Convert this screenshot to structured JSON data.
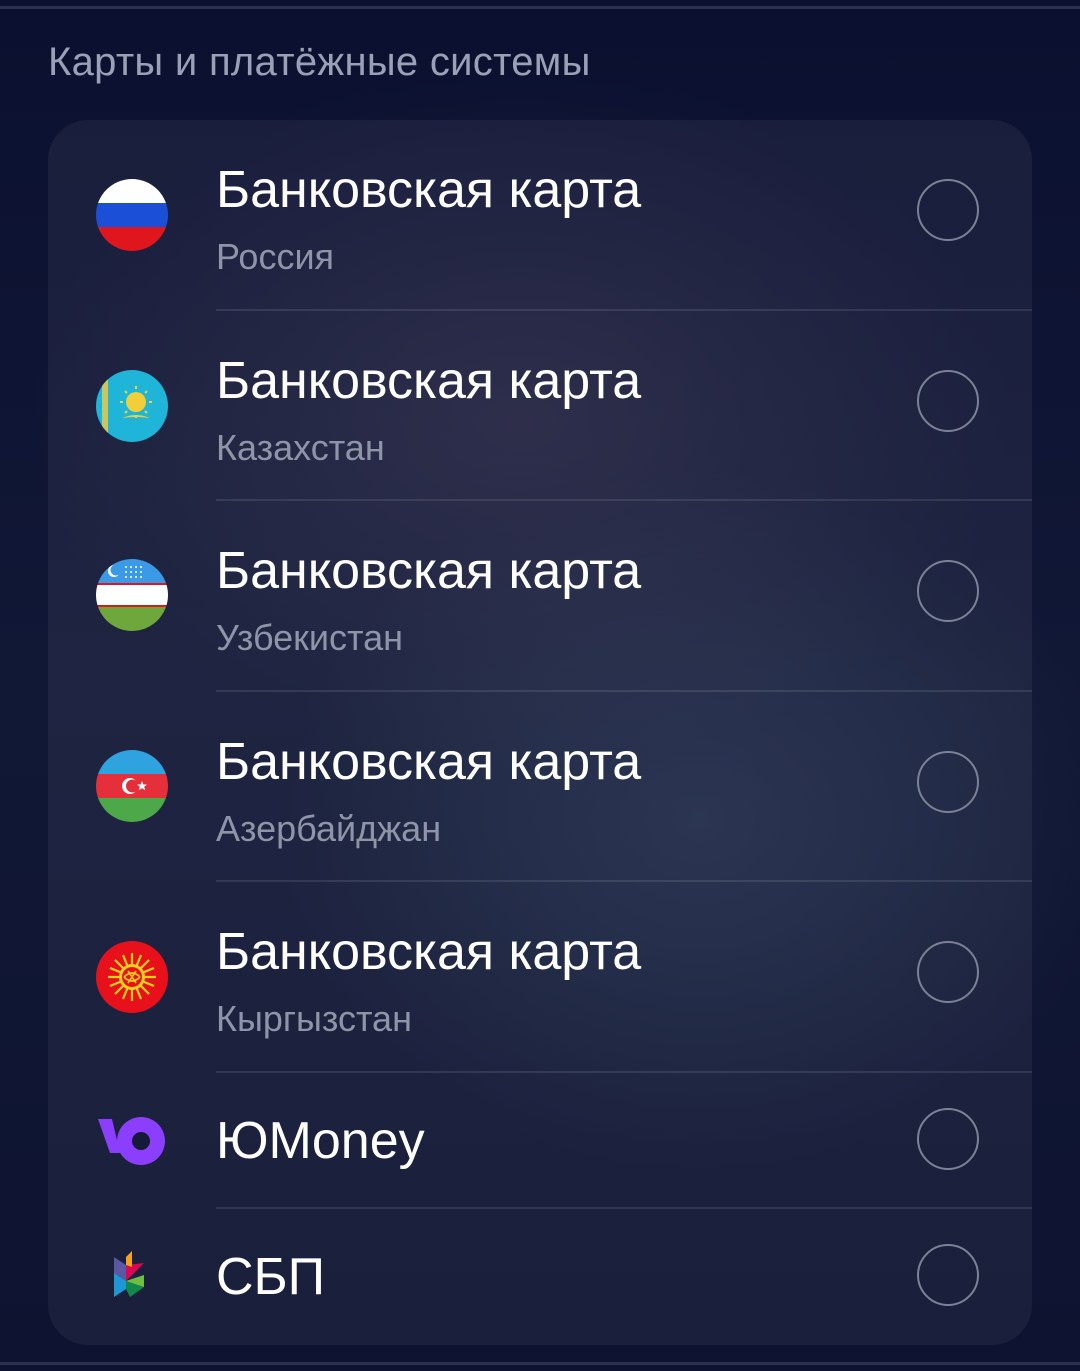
{
  "section": {
    "title": "Карты и платёжные системы"
  },
  "options": [
    {
      "title": "Банковская карта",
      "subtitle": "Россия",
      "icon": "russia-flag-icon"
    },
    {
      "title": "Банковская карта",
      "subtitle": "Казахстан",
      "icon": "kazakhstan-flag-icon"
    },
    {
      "title": "Банковская карта",
      "subtitle": "Узбекистан",
      "icon": "uzbekistan-flag-icon"
    },
    {
      "title": "Банковская карта",
      "subtitle": "Азербайджан",
      "icon": "azerbaijan-flag-icon"
    },
    {
      "title": "Банковская карта",
      "subtitle": "Кыргызстан",
      "icon": "kyrgyzstan-flag-icon"
    },
    {
      "title": "ЮMoney",
      "icon": "yoomoney-logo-icon"
    },
    {
      "title": "СБП",
      "icon": "sbp-logo-icon"
    }
  ],
  "colors": {
    "background": "#0b1130",
    "card": "#1c2240",
    "title_text": "#ffffff",
    "subtitle_text": "#8f95a8",
    "radio_border": "#7c8295",
    "yoomoney_purple": "#8b3ffd"
  }
}
